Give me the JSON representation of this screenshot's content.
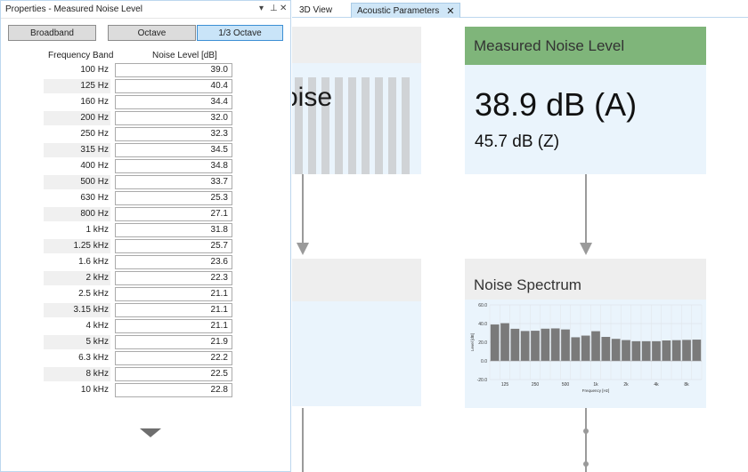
{
  "properties_panel": {
    "title": "Properties - Measured Noise Level",
    "controls": {
      "dropdown": "▾",
      "pin": "⊥",
      "close": "✕"
    },
    "modes": [
      "Broadband",
      "Octave",
      "1/3 Octave"
    ],
    "selected_mode": "1/3 Octave",
    "col_band": "Frequency Band",
    "col_level": "Noise Level [dB]",
    "rows": [
      {
        "band": "100 Hz",
        "value": "39.0"
      },
      {
        "band": "125 Hz",
        "value": "40.4"
      },
      {
        "band": "160 Hz",
        "value": "34.4"
      },
      {
        "band": "200 Hz",
        "value": "32.0"
      },
      {
        "band": "250 Hz",
        "value": "32.3"
      },
      {
        "band": "315 Hz",
        "value": "34.5"
      },
      {
        "band": "400 Hz",
        "value": "34.8"
      },
      {
        "band": "500 Hz",
        "value": "33.7"
      },
      {
        "band": "630 Hz",
        "value": "25.3"
      },
      {
        "band": "800 Hz",
        "value": "27.1"
      },
      {
        "band": "1 kHz",
        "value": "31.8"
      },
      {
        "band": "1.25 kHz",
        "value": "25.7"
      },
      {
        "band": "1.6 kHz",
        "value": "23.6"
      },
      {
        "band": "2 kHz",
        "value": "22.3"
      },
      {
        "band": "2.5 kHz",
        "value": "21.1"
      },
      {
        "band": "3.15 kHz",
        "value": "21.1"
      },
      {
        "band": "4 kHz",
        "value": "21.1"
      },
      {
        "band": "5 kHz",
        "value": "21.9"
      },
      {
        "band": "6.3 kHz",
        "value": "22.2"
      },
      {
        "band": "8 kHz",
        "value": "22.5"
      },
      {
        "band": "10 kHz",
        "value": "22.8"
      }
    ]
  },
  "tabs": [
    {
      "label": "3D View",
      "active": false
    },
    {
      "label": "Acoustic Parameters",
      "active": true,
      "close": "✕"
    }
  ],
  "canvas": {
    "partial_card_text": "oise",
    "measured_card": {
      "title": "Measured Noise Level",
      "value_a": "38.9  dB (A)",
      "value_z": "45.7  dB (Z)",
      "header_color": "#7fb57a"
    },
    "spectrum_card": {
      "title": "Noise Spectrum"
    }
  },
  "chart_data": {
    "type": "bar",
    "ylabel": "Level [dB]",
    "xlabel": "Frequency [Hz]",
    "ylim": [
      -20,
      60
    ],
    "yticks": [
      "60.0",
      "40.0",
      "20.0",
      "0.0",
      "-20.0"
    ],
    "xticks": [
      "125",
      "250",
      "500",
      "1k",
      "2k",
      "4k",
      "8k"
    ],
    "values": [
      39.0,
      40.4,
      34.4,
      32.0,
      32.3,
      34.5,
      34.8,
      33.7,
      25.3,
      27.1,
      31.8,
      25.7,
      23.6,
      22.3,
      21.1,
      21.1,
      21.1,
      21.9,
      22.2,
      22.5,
      22.8
    ],
    "bar_color": "#7a7a7a",
    "grid": true
  }
}
